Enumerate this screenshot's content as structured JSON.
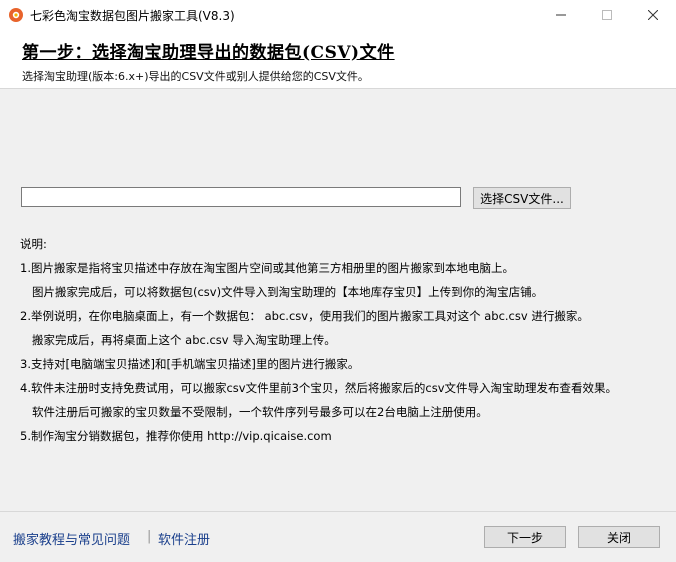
{
  "window": {
    "title": "七彩色淘宝数据包图片搬家工具(V8.3)",
    "controls": [
      "minimize",
      "maximize",
      "close"
    ]
  },
  "header": {
    "step_title": "第一步：选择淘宝助理导出的数据包(CSV)文件",
    "subtitle": "选择淘宝助理(版本:6.x+)导出的CSV文件或别人提供给您的CSV文件。"
  },
  "file": {
    "path_value": "",
    "select_label": "选择CSV文件..."
  },
  "description": {
    "heading": "说明:",
    "lines": [
      "1.图片搬家是指将宝贝描述中存放在淘宝图片空间或其他第三方相册里的图片搬家到本地电脑上。",
      "图片搬家完成后，可以将数据包(csv)文件导入到淘宝助理的【本地库存宝贝】上传到你的淘宝店铺。",
      "2.举例说明，在你电脑桌面上，有一个数据包： abc.csv，使用我们的图片搬家工具对这个 abc.csv 进行搬家。",
      "搬家完成后，再将桌面上这个 abc.csv 导入淘宝助理上传。",
      "3.支持对[电脑端宝贝描述]和[手机端宝贝描述]里的图片进行搬家。",
      "4.软件未注册时支持免费试用，可以搬家csv文件里前3个宝贝，然后将搬家后的csv文件导入淘宝助理发布查看效果。",
      "软件注册后可搬家的宝贝数量不受限制，一个软件序列号最多可以在2台电脑上注册使用。",
      "5.制作淘宝分销数据包，推荐你使用 http://vip.qicaise.com"
    ]
  },
  "footer": {
    "tutorial_link": "搬家教程与常见问题",
    "separator": "|",
    "register_link": "软件注册",
    "next_label": "下一步",
    "close_label": "关闭"
  },
  "colors": {
    "link": "#1a3f8c",
    "app_icon": "#e8632b"
  }
}
